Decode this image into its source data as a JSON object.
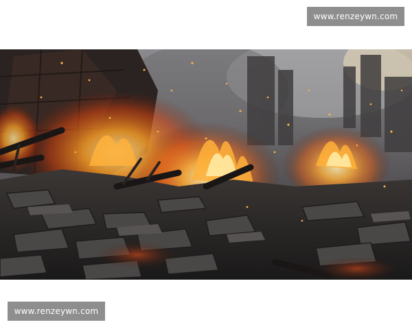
{
  "watermark_top": {
    "text": "www.renzeywn.com"
  },
  "watermark_bottom": {
    "text": "www.renzeywn.com"
  },
  "scene": {
    "subject": "fire-rubble-scene",
    "colors": {
      "sky": "#6e6e72",
      "smoke": "#9a9aa0",
      "fire_core": "#ffe08a",
      "fire_mid": "#ff9a1f",
      "fire_outer": "#e2450c",
      "rubble": "#2c2b2b",
      "rubble_light": "#4a4847",
      "ember": "#ffb347"
    }
  }
}
